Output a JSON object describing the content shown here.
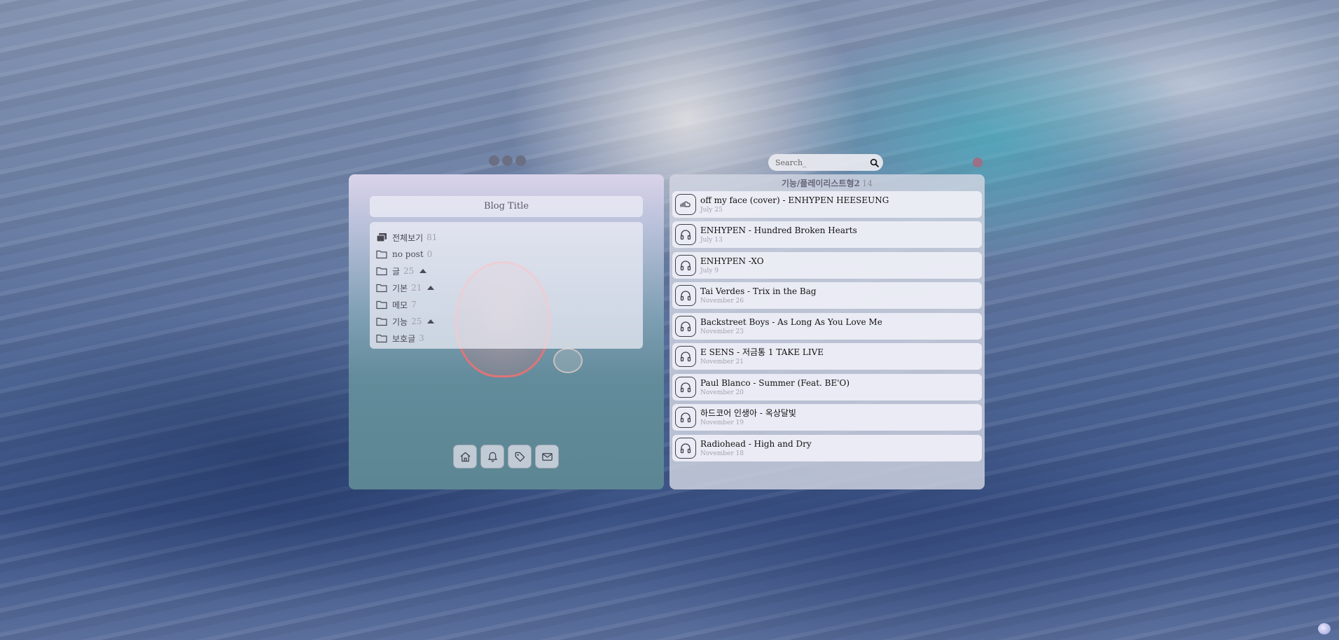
{
  "window_controls": {
    "dot_color": "#6b6f83"
  },
  "blog": {
    "title": "Blog Title"
  },
  "categories": [
    {
      "label": "전체보기",
      "count": "81",
      "icon": "stack-icon",
      "expandable": false
    },
    {
      "label": "no post",
      "count": "0",
      "icon": "folder-icon",
      "expandable": false
    },
    {
      "label": "글",
      "count": "25",
      "icon": "folder-icon",
      "expandable": true
    },
    {
      "label": "기본",
      "count": "21",
      "icon": "folder-icon",
      "expandable": true
    },
    {
      "label": "메모",
      "count": "7",
      "icon": "folder-icon",
      "expandable": false
    },
    {
      "label": "기능",
      "count": "25",
      "icon": "folder-icon",
      "expandable": true
    },
    {
      "label": "보호글",
      "count": "3",
      "icon": "folder-icon",
      "expandable": false
    }
  ],
  "dock": [
    "home-icon",
    "bell-icon",
    "tag-icon",
    "mail-icon"
  ],
  "search": {
    "placeholder": "Search_"
  },
  "list": {
    "category": "기능/플레이리스트형2",
    "count": "14",
    "items": [
      {
        "title": "off my face (cover) - ENHYPEN HEESEUNG",
        "date": "July 25",
        "icon": "soundcloud-icon"
      },
      {
        "title": "ENHYPEN - Hundred Broken Hearts",
        "date": "July 13",
        "icon": "headphones-icon"
      },
      {
        "title": "ENHYPEN -XO",
        "date": "July 9",
        "icon": "headphones-icon"
      },
      {
        "title": "Tai Verdes - Trix in the Bag",
        "date": "November 26",
        "icon": "headphones-icon"
      },
      {
        "title": "Backstreet Boys - As Long As You Love Me",
        "date": "November 23",
        "icon": "headphones-icon"
      },
      {
        "title": "E SENS - 저금통 1 TAKE LIVE",
        "date": "November 21",
        "icon": "headphones-icon"
      },
      {
        "title": "Paul Blanco - Summer (Feat. BE'O)",
        "date": "November 20",
        "icon": "headphones-icon"
      },
      {
        "title": "하드코어 인생아 - 옥상달빛",
        "date": "November 19",
        "icon": "headphones-icon"
      },
      {
        "title": "Radiohead - High and Dry",
        "date": "November 18",
        "icon": "headphones-icon"
      }
    ]
  },
  "colors": {
    "accent_dot": "#9a7186",
    "panel_bg": "#eeeef6"
  }
}
